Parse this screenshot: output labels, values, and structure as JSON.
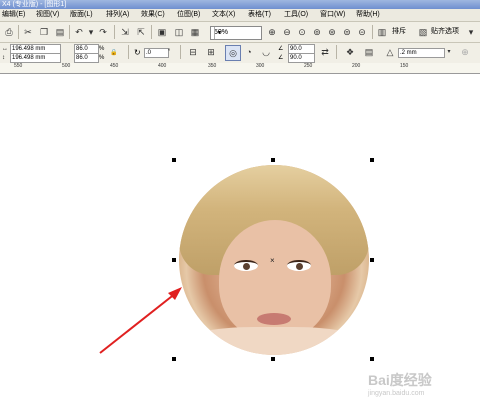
{
  "window": {
    "title": "X4 (专业版) - [图形1]"
  },
  "menu": [
    "编辑(E)",
    "视图(V)",
    "版面(L)",
    "排列(A)",
    "效果(C)",
    "位图(B)",
    "文本(X)",
    "表格(T)",
    "工具(O)",
    "窗口(W)",
    "帮助(H)"
  ],
  "toolbar": {
    "zoom_value": "50%",
    "arrange_label": "排斥",
    "snap_label": "贴齐选项"
  },
  "property_bar": {
    "x_value": "196.498 mm",
    "y_value": "196.498 mm",
    "width_pct": "86.0",
    "height_pct": "86.0",
    "pct_unit": "%",
    "rotation": ".0",
    "angle1": "90.0",
    "angle2": "90.0",
    "outline_width": ".2 mm"
  },
  "ruler": {
    "ticks": [
      "550",
      "500",
      "450",
      "400",
      "350",
      "300",
      "250",
      "200",
      "150"
    ]
  },
  "watermark": {
    "main": "Bai度经验",
    "sub": "jingyan.baidu.com"
  },
  "colors": {
    "arrow": "#e02020",
    "titlebar": "#7f9dd6",
    "menubar": "#eceae0"
  }
}
